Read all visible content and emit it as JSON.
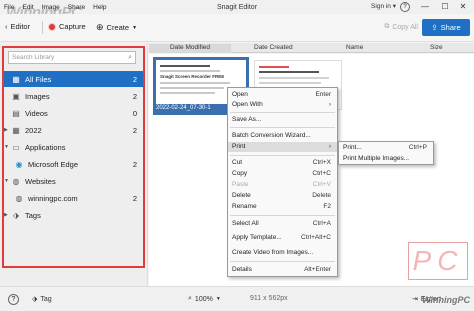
{
  "titlebar": {
    "menu": [
      "File",
      "Edit",
      "Image",
      "Share",
      "Help"
    ],
    "title": "Snagit Editor",
    "sign_in": "Sign in ▾",
    "help": "?",
    "minimize": "—",
    "maximize": "☐",
    "close": "✕",
    "watermark": "WinningPC"
  },
  "toolbar": {
    "editor_label": "Editor",
    "capture_label": "Capture",
    "create_label": "Create",
    "copy_all_label": "Copy All",
    "share_label": "Share",
    "accent_color": "#1f6fc5"
  },
  "library": {
    "search_placeholder": "Search Library",
    "items": [
      {
        "icon": "grid-icon",
        "label": "All Files",
        "count": "2",
        "active": true
      },
      {
        "icon": "image-icon",
        "label": "Images",
        "count": "2"
      },
      {
        "icon": "video-icon",
        "label": "Videos",
        "count": "0"
      },
      {
        "icon": "calendar-icon",
        "label": "2022",
        "count": "2"
      },
      {
        "icon": "applications-icon",
        "label": "Applications",
        "count": ""
      },
      {
        "icon": "edge-icon",
        "label": "Microsoft Edge",
        "count": "2"
      },
      {
        "icon": "globe-icon",
        "label": "Websites",
        "count": ""
      },
      {
        "icon": "globe-icon",
        "label": "winningpc.com",
        "count": "2"
      },
      {
        "icon": "tag-icon",
        "label": "Tags",
        "count": ""
      }
    ]
  },
  "columns": [
    "Date Modified",
    "Date Created",
    "Name",
    "Size"
  ],
  "thumbnails": {
    "first_caption": "2022-02-24_07-30-1",
    "first_heading": "Snagit Screen Recorder FREE"
  },
  "context_menu": {
    "items": [
      {
        "label": "Open",
        "shortcut": "Enter"
      },
      {
        "label": "Open With",
        "shortcut": "›"
      },
      {
        "sep": true
      },
      {
        "label": "Save As...",
        "shortcut": ""
      },
      {
        "sep": true
      },
      {
        "label": "Batch Conversion Wizard...",
        "shortcut": ""
      },
      {
        "label": "Print",
        "shortcut": "›",
        "hover": true
      },
      {
        "sep": true
      },
      {
        "label": "Cut",
        "shortcut": "Ctrl+X"
      },
      {
        "label": "Copy",
        "shortcut": "Ctrl+C"
      },
      {
        "label": "Paste",
        "shortcut": "Ctrl+V",
        "disabled": true
      },
      {
        "label": "Delete",
        "shortcut": "Delete"
      },
      {
        "label": "Rename",
        "shortcut": "F2"
      },
      {
        "sep": true
      },
      {
        "label": "Select All",
        "shortcut": "Ctrl+A"
      },
      {
        "label": "Apply Template...",
        "shortcut": "Ctrl+Alt+C"
      },
      {
        "label": "Create Video from Images...",
        "shortcut": ""
      },
      {
        "sep": true
      },
      {
        "label": "Details",
        "shortcut": "Alt+Enter"
      }
    ],
    "print_submenu": [
      {
        "label": "Print...",
        "shortcut": "Ctrl+P"
      },
      {
        "label": "Print Multiple Images...",
        "shortcut": ""
      }
    ]
  },
  "statusbar": {
    "help": "?",
    "tag_label": "Tag",
    "zoom": "100%",
    "dimensions": "911 x 562px",
    "export_label": "Export",
    "watermark": "WinningPC"
  }
}
